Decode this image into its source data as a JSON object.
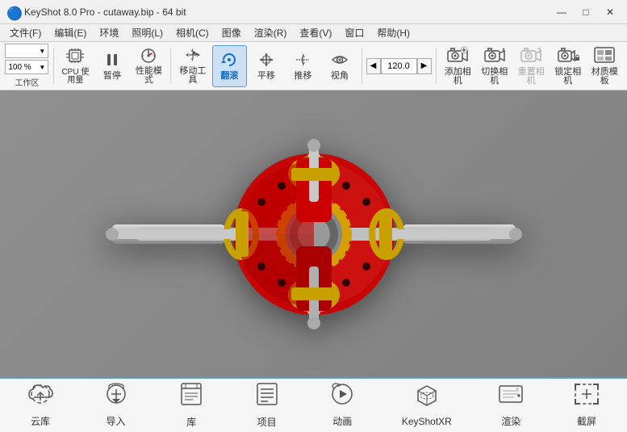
{
  "titleBar": {
    "icon": "⚙",
    "title": "KeyShot 8.0 Pro  -  cutaway.bip  -  64 bit",
    "minimize": "—",
    "maximize": "□",
    "close": "✕"
  },
  "menuBar": {
    "items": [
      {
        "label": "文件(F)"
      },
      {
        "label": "编辑(E)"
      },
      {
        "label": "环境"
      },
      {
        "label": "照明(L)"
      },
      {
        "label": "相机(C)"
      },
      {
        "label": "图像"
      },
      {
        "label": "渲染(R)"
      },
      {
        "label": "查看(V)"
      },
      {
        "label": "窗口"
      },
      {
        "label": "帮助(H)"
      }
    ]
  },
  "toolbar": {
    "workspace": "",
    "zoom": "100 %",
    "tools": [
      {
        "id": "workspace",
        "label": "工作区",
        "icon": "⊞"
      },
      {
        "id": "cpu",
        "label": "CPU 使用量",
        "icon": "📊"
      },
      {
        "id": "pause",
        "label": "暂停",
        "icon": "⏸"
      },
      {
        "id": "performance",
        "label": "性能模式",
        "icon": "⚡"
      },
      {
        "id": "move",
        "label": "移动工具",
        "icon": "✥"
      },
      {
        "id": "rotate",
        "label": "翻滚",
        "icon": "↻",
        "active": true
      },
      {
        "id": "pan",
        "label": "平移",
        "icon": "✦"
      },
      {
        "id": "push",
        "label": "推移",
        "icon": "↕"
      },
      {
        "id": "view",
        "label": "视角",
        "icon": "👁"
      },
      {
        "id": "camera-value",
        "label": "120.0",
        "icon": ""
      },
      {
        "id": "add-camera",
        "label": "添加相机",
        "icon": "📷"
      },
      {
        "id": "switch-camera",
        "label": "切换相机",
        "icon": "🔄"
      },
      {
        "id": "reset-camera",
        "label": "重置相机",
        "icon": "↺"
      },
      {
        "id": "lock-camera",
        "label": "锁定相机",
        "icon": "🔒"
      },
      {
        "id": "material",
        "label": "材质模板",
        "icon": "🎨"
      }
    ],
    "cameraValue": "120.0"
  },
  "bottomBar": {
    "items": [
      {
        "id": "cloud",
        "label": "云库",
        "icon": "☁"
      },
      {
        "id": "import",
        "label": "导入",
        "icon": "⊕"
      },
      {
        "id": "library",
        "label": "库",
        "icon": "📖"
      },
      {
        "id": "project",
        "label": "项目",
        "icon": "☰"
      },
      {
        "id": "animation",
        "label": "动画",
        "icon": "▶"
      },
      {
        "id": "keyshotxr",
        "label": "KeyShotXR",
        "icon": "⬡"
      },
      {
        "id": "render",
        "label": "渲染",
        "icon": "⊕"
      },
      {
        "id": "screenshot",
        "label": "截屏",
        "icon": "⊞"
      }
    ]
  }
}
